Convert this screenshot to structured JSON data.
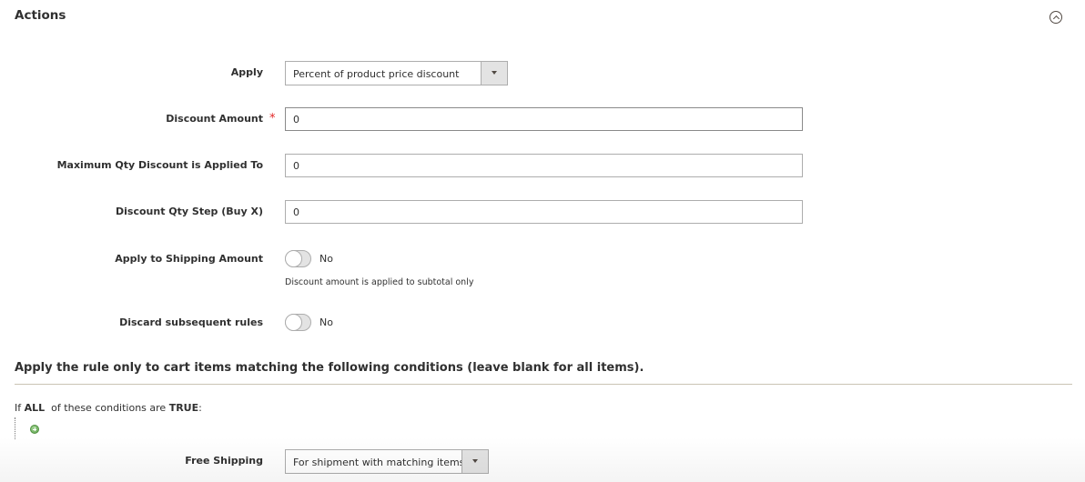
{
  "section": {
    "title": "Actions",
    "collapse_icon": "chevron-up-circle-icon"
  },
  "fields": {
    "apply": {
      "label": "Apply",
      "value": "Percent of product price discount"
    },
    "discount_amount": {
      "label": "Discount Amount",
      "required_mark": "*",
      "value": "0"
    },
    "max_qty": {
      "label": "Maximum Qty Discount is Applied To",
      "value": "0"
    },
    "qty_step": {
      "label": "Discount Qty Step (Buy X)",
      "value": "0"
    },
    "apply_shipping": {
      "label": "Apply to Shipping Amount",
      "state": "No",
      "note": "Discount amount is applied to subtotal only"
    },
    "discard_rules": {
      "label": "Discard subsequent rules",
      "state": "No"
    },
    "free_shipping": {
      "label": "Free Shipping",
      "value": "For shipment with matching items"
    }
  },
  "conditions": {
    "title": "Apply the rule only to cart items matching the following conditions (leave blank for all items).",
    "prefix": "If",
    "aggregator": "ALL",
    "middle": "of these conditions are",
    "value": "TRUE",
    "suffix": ":",
    "add_icon": "add-condition-icon"
  },
  "colors": {
    "required": "#e22626",
    "text": "#303030",
    "border": "#adadad",
    "divider": "#cac3b4"
  }
}
